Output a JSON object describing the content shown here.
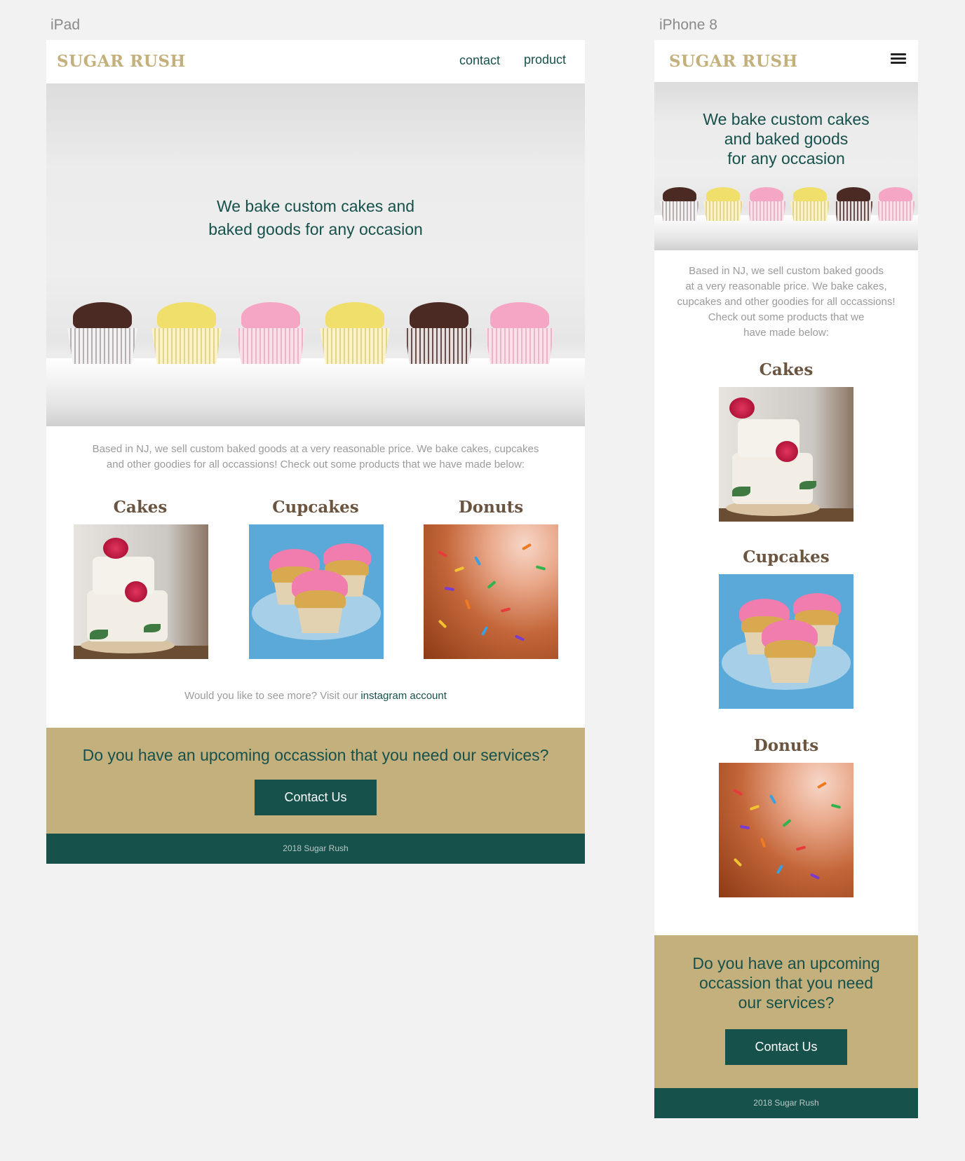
{
  "frames": {
    "ipad_label": "iPad",
    "iphone_label": "iPhone 8"
  },
  "site": {
    "logo": "SUGAR RUSH",
    "nav": [
      "contact",
      "product"
    ],
    "hero_line1_ipad": "We bake custom cakes and",
    "hero_line2_ipad": "baked goods for any occasion",
    "hero_lines_iphone": [
      "We bake custom cakes",
      "and baked goods",
      "for any occasion"
    ],
    "intro_ipad": [
      "Based in NJ, we sell custom baked goods at a very reasonable price. We bake cakes, cupcakes",
      "and other goodies for all occassions! Check out some products that we have made below:"
    ],
    "intro_iphone": [
      "Based in NJ, we sell custom baked goods",
      "at a very reasonable price. We bake cakes,",
      "cupcakes and other goodies for all occassions!",
      "Check out some products that we",
      "have made below:"
    ],
    "products": [
      "Cakes",
      "Cupcakes",
      "Donuts"
    ],
    "more_text": "Would you like to see more? Visit our ",
    "more_link": "instagram account",
    "cta_ipad": "Do you have an upcoming occassion that you need our services?",
    "cta_iphone": [
      "Do you have an upcoming",
      "occassion that you need",
      "our services?"
    ],
    "cta_button": "Contact Us",
    "footer": "2018 Sugar Rush"
  },
  "colors": {
    "brand_gold": "#c4b07c",
    "brand_green": "#16514c",
    "product_title": "#6b5440",
    "body_text": "#9b9b9b",
    "canvas": "#f2f2f2"
  },
  "icons": [
    "hamburger-menu-icon"
  ]
}
